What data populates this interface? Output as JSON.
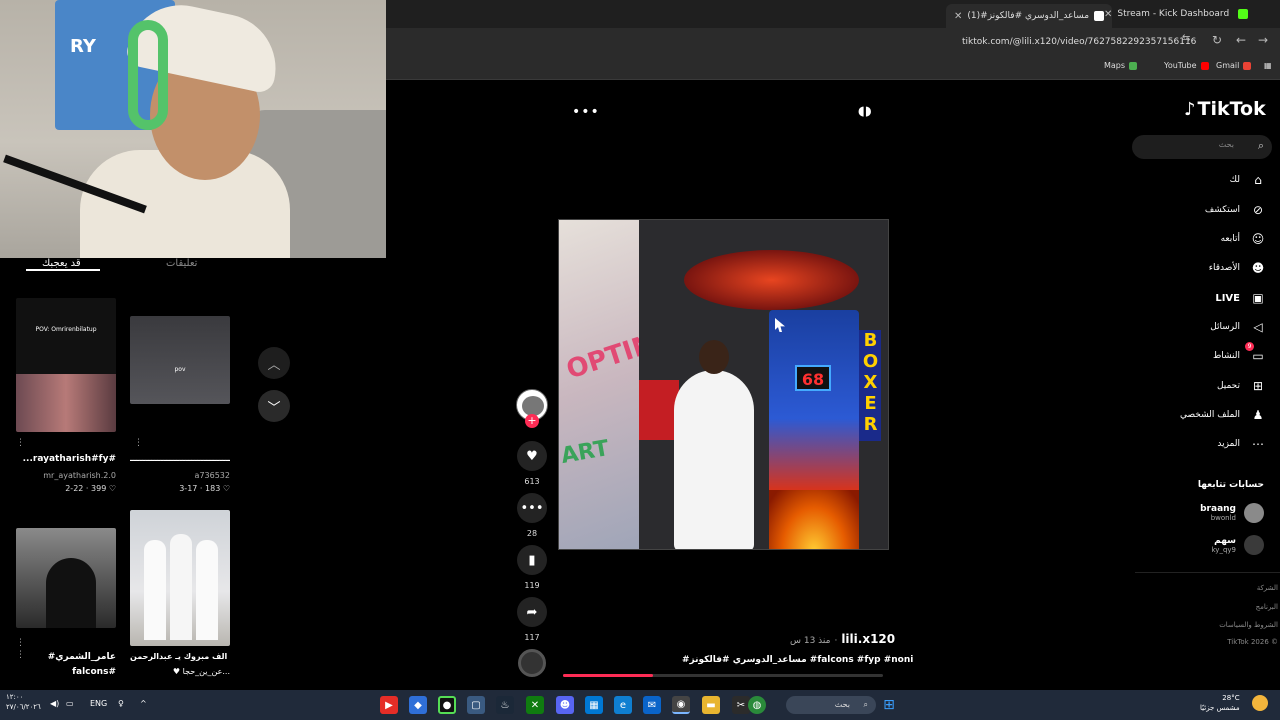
{
  "browser": {
    "tabs": [
      {
        "label": "Stream - Kick Dashboard",
        "favicon_color": "#53fc18"
      },
      {
        "label": "(1)#مساعد_الدوسري #فالكونز",
        "favicon_color": "#ffffff"
      }
    ],
    "url": "tiktok.com/@lili.x120/video/7627582292357156116",
    "bookmarks": [
      "Gmail",
      "YouTube",
      "Maps"
    ]
  },
  "profile_panel": {
    "tabs": [
      "قد يعجبك",
      "تعليقات"
    ],
    "cards": [
      {
        "overlay": "POV: Omrirenbilatup",
        "title": "...rayatharish#fy#",
        "author": "mr_ayatharish.2.0",
        "date": "2-22",
        "likes": "399 ♡"
      },
      {
        "overlay": "pov",
        "title": "ـــــــــــــــــــــــــــــــــــ",
        "author": "a736532",
        "date": "3-17",
        "likes": "183 ♡"
      },
      {
        "overlay": "",
        "title": "#عامر_الشمري",
        "author": "falcons#",
        "date": "",
        "likes": ""
      },
      {
        "overlay": "",
        "title": "الف مبروك يـ عبدالرحمن ✨",
        "author": "♥ عن_ين_حجا...",
        "date": "",
        "likes": ""
      }
    ]
  },
  "video": {
    "overlay_score": "68",
    "boxer_text": "BOXER",
    "graffiti_1": "OPTIMI",
    "graffiti_2": "ART",
    "progress": 0.28
  },
  "actions": {
    "likes": "613",
    "comments": "28",
    "saves": "119",
    "shares": "117"
  },
  "caption": {
    "username": "lili.x120",
    "time": "منذ 13 س",
    "tags": "#مساعد_الدوسري #فالكونز #falcons #fyp #noni"
  },
  "sidebar": {
    "logo": "TikTok",
    "search_placeholder": "بحث",
    "nav": [
      {
        "label": "لك",
        "icon": "home-icon"
      },
      {
        "label": "استكشف",
        "icon": "compass-icon"
      },
      {
        "label": "أتابعه",
        "icon": "user-follow-icon"
      },
      {
        "label": "الأصدقاء",
        "icon": "friends-icon"
      },
      {
        "label": "LIVE",
        "icon": "live-icon"
      },
      {
        "label": "الرسائل",
        "icon": "send-icon"
      },
      {
        "label": "النشاط",
        "icon": "inbox-icon"
      },
      {
        "label": "تحميل",
        "icon": "upload-icon"
      },
      {
        "label": "الملف الشخصي",
        "icon": "profile-icon"
      },
      {
        "label": "المزيد",
        "icon": "more-icon"
      }
    ],
    "activity_badge": "9",
    "following_title": "حسابات تتابعها",
    "following": [
      {
        "name": "braang",
        "handle": "bwonld"
      },
      {
        "name": "سهم",
        "handle": "ky_qy9"
      }
    ],
    "footer": [
      "الشركة",
      "البرنامج",
      "الشروط والسياسات",
      "TikTok 2026 ©"
    ]
  },
  "taskbar": {
    "clock": "١٢:٠٠",
    "date": "٢٧/٠٦/٢٠٢٦",
    "lang": "ENG",
    "search_label": "بحث",
    "temp": "28°C",
    "weather": "مشمس جزئيًا"
  },
  "colors": {
    "accent": "#fe2c55",
    "taskbar": "#202a3a"
  }
}
